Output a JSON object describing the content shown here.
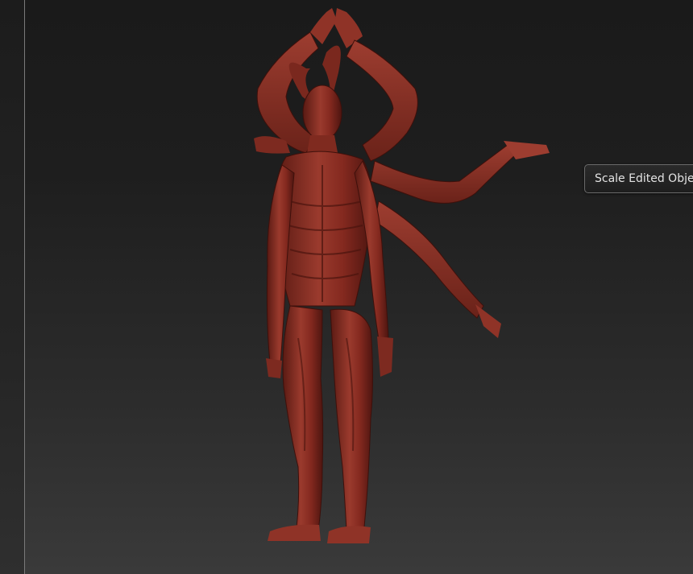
{
  "tooltip": {
    "text": "Scale Edited Obje"
  },
  "colors": {
    "model": "#8a2f24",
    "model_highlight": "#b0473a",
    "model_shadow": "#4d1510",
    "background_top": "#1a1a1a",
    "background_bottom": "#3a3a3a"
  },
  "icons": {
    "model": "sculpted-demon-figure"
  }
}
